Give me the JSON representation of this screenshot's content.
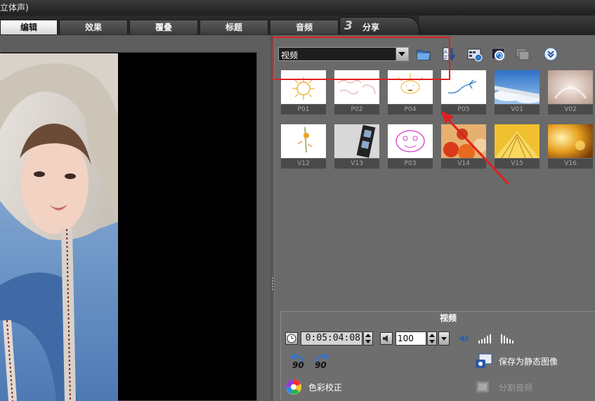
{
  "window": {
    "title_fragment": "立体声)"
  },
  "tabs": [
    {
      "label": "编辑",
      "active": true
    },
    {
      "label": "效果",
      "active": false
    },
    {
      "label": "覆叠",
      "active": false
    },
    {
      "label": "标题",
      "active": false
    },
    {
      "label": "音频",
      "active": false
    }
  ],
  "share_tab": {
    "number": "3",
    "label": "分享"
  },
  "library": {
    "category_value": "视频",
    "toolbar_icons": [
      "open-folder-icon",
      "sort-icon",
      "library-manager-icon",
      "capture-icon",
      "batch-icon",
      "expand-icon"
    ],
    "items": [
      {
        "label": "P01",
        "icon": "sun-doodle-icon"
      },
      {
        "label": "P02",
        "icon": "world-map-icon"
      },
      {
        "label": "P04",
        "icon": "sun-sketch-icon"
      },
      {
        "label": "P05",
        "icon": "airplane-doodle-icon"
      },
      {
        "label": "V01",
        "icon": "airplane-wing-photo"
      },
      {
        "label": "V02",
        "icon": "soft-light-photo"
      },
      {
        "label": "V12",
        "icon": "flower-doodle-icon"
      },
      {
        "label": "V13",
        "icon": "film-strip-photo"
      },
      {
        "label": "P03",
        "icon": "face-doodle-icon"
      },
      {
        "label": "V14",
        "icon": "fruit-photo"
      },
      {
        "label": "V15",
        "icon": "book-pages-photo"
      },
      {
        "label": "V16",
        "icon": "golden-light-photo"
      }
    ]
  },
  "options_panel": {
    "title": "视频",
    "duration": "0:05:04:08",
    "volume": "100",
    "rotate_left_label": "90",
    "rotate_right_label": "90",
    "save_still_label": "保存为静态图像",
    "color_correction_label": "色彩校正",
    "split_audio_label": "分割音频"
  },
  "colors": {
    "highlight": "#e02020",
    "arrow": "#e02020"
  }
}
